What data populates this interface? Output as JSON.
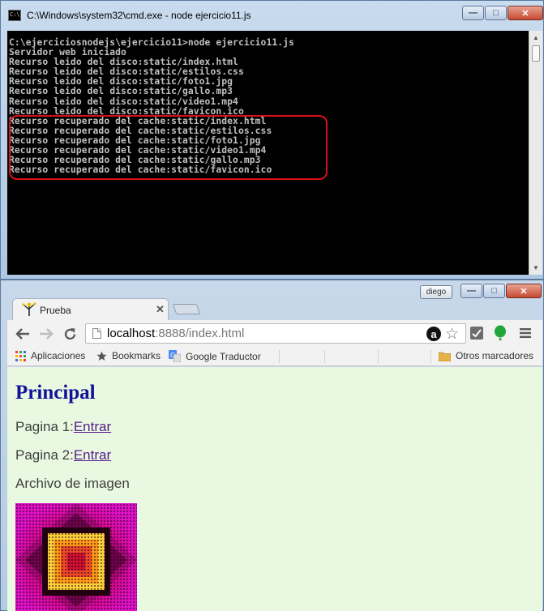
{
  "cmd": {
    "title": "C:\\Windows\\system32\\cmd.exe - node  ejercicio11.js",
    "lines": [
      "C:\\ejerciciosnodejs\\ejercicio11>node ejercicio11.js",
      "Servidor web iniciado",
      "Recurso leido del disco:static/index.html",
      "Recurso leido del disco:static/estilos.css",
      "Recurso leido del disco:static/foto1.jpg",
      "Recurso leido del disco:static/gallo.mp3",
      "Recurso leido del disco:static/video1.mp4",
      "Recurso leido del disco:static/favicon.ico",
      "Recurso recuperado del cache:static/index.html",
      "Recurso recuperado del cache:static/estilos.css",
      "Recurso recuperado del cache:static/foto1.jpg",
      "Recurso recuperado del cache:static/video1.mp4",
      "Recurso recuperado del cache:static/gallo.mp3",
      "Recurso recuperado del cache:static/favicon.ico"
    ],
    "highlight_color": "#d4101a"
  },
  "window_buttons": {
    "minimize": "—",
    "maximize": "□",
    "close": "✕"
  },
  "browser": {
    "profile": "diego",
    "tab": {
      "title": "Prueba",
      "close": "✕"
    },
    "url_host": "localhost",
    "url_rest": ":8888/index.html",
    "ext_a": "a",
    "bookmarks": [
      {
        "label": "Aplicaciones",
        "icon": "apps-grid-icon"
      },
      {
        "label": "Bookmarks",
        "icon": "star-icon"
      },
      {
        "label": "Google Traductor",
        "icon": "translate-icon"
      }
    ],
    "other_bookmarks": "Otros marcadores"
  },
  "page": {
    "heading": "Principal",
    "p1_label": "Pagina 1:",
    "p1_link": "Entrar",
    "p2_label": "Pagina 2:",
    "p2_link": "Entrar",
    "image_caption": "Archivo de imagen",
    "bg_color": "#e9f9e1",
    "heading_color": "#11119a"
  }
}
